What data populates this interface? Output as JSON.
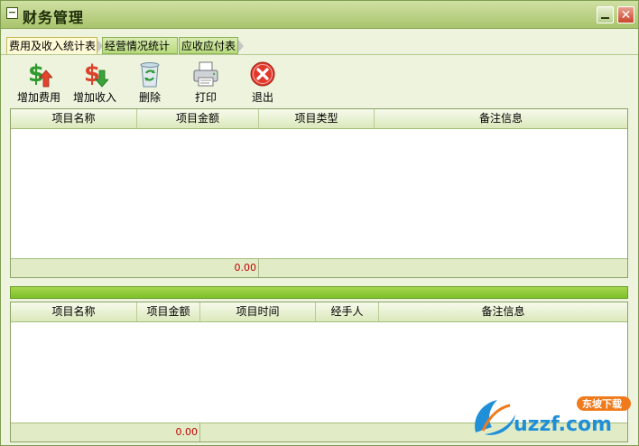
{
  "window": {
    "title": "财务管理"
  },
  "tabs": [
    {
      "label": "费用及收入统计表",
      "active": true
    },
    {
      "label": "经营情况统计",
      "active": false
    },
    {
      "label": "应收应付表",
      "active": false
    }
  ],
  "toolbar": {
    "add_expense": {
      "label": "增加费用",
      "icon": "money-up-icon"
    },
    "add_income": {
      "label": "增加收入",
      "icon": "money-down-icon"
    },
    "delete": {
      "label": "删除",
      "icon": "recycle-bin-icon"
    },
    "print": {
      "label": "打印",
      "icon": "printer-icon"
    },
    "exit": {
      "label": "退出",
      "icon": "close-circle-icon"
    }
  },
  "top_table": {
    "columns": [
      "项目名称",
      "项目金额",
      "项目类型",
      "备注信息"
    ],
    "rows": [],
    "total": "0.00"
  },
  "bottom_table": {
    "columns": [
      "项目名称",
      "项目金额",
      "项目时间",
      "经手人",
      "备注信息"
    ],
    "rows": [],
    "total": "0.00"
  },
  "watermark": {
    "site": "uzzf.com",
    "badge": "东坡下载"
  },
  "colors": {
    "title_bar": "#b7cf82",
    "splitter": "#8ccc38",
    "total_text": "#c00000"
  }
}
